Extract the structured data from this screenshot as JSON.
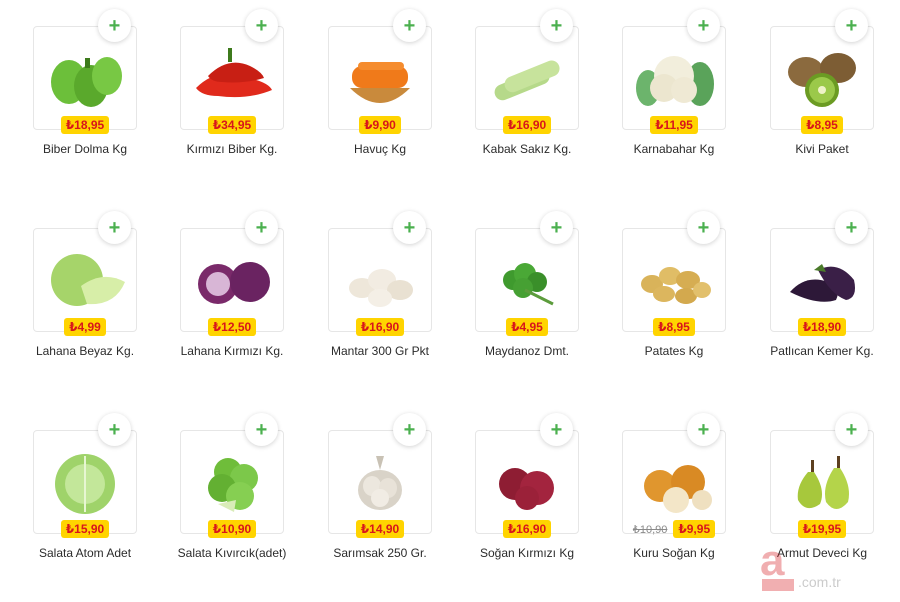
{
  "products": [
    {
      "name": "Biber Dolma Kg",
      "price": "₺18,95",
      "old_price": "",
      "icon": "green-pepper-icon"
    },
    {
      "name": "Kırmızı Biber Kg.",
      "price": "₺34,95",
      "old_price": "",
      "icon": "red-pepper-icon"
    },
    {
      "name": "Havuç Kg",
      "price": "₺9,90",
      "old_price": "",
      "icon": "carrot-icon"
    },
    {
      "name": "Kabak Sakız Kg.",
      "price": "₺16,90",
      "old_price": "",
      "icon": "zucchini-icon"
    },
    {
      "name": "Karnabahar Kg",
      "price": "₺11,95",
      "old_price": "",
      "icon": "cauliflower-icon"
    },
    {
      "name": "Kivi Paket",
      "price": "₺8,95",
      "old_price": "",
      "icon": "kiwi-icon"
    },
    {
      "name": "Lahana Beyaz Kg.",
      "price": "₺4,99",
      "old_price": "",
      "icon": "white-cabbage-icon"
    },
    {
      "name": "Lahana Kırmızı Kg.",
      "price": "₺12,50",
      "old_price": "",
      "icon": "red-cabbage-icon"
    },
    {
      "name": "Mantar 300 Gr Pkt",
      "price": "₺16,90",
      "old_price": "",
      "icon": "mushroom-icon"
    },
    {
      "name": "Maydanoz Dmt.",
      "price": "₺4,95",
      "old_price": "",
      "icon": "parsley-icon"
    },
    {
      "name": "Patates Kg",
      "price": "₺8,95",
      "old_price": "",
      "icon": "potato-icon"
    },
    {
      "name": "Patlıcan Kemer Kg.",
      "price": "₺18,90",
      "old_price": "",
      "icon": "eggplant-icon"
    },
    {
      "name": "Salata Atom Adet",
      "price": "₺15,90",
      "old_price": "",
      "icon": "iceberg-lettuce-icon"
    },
    {
      "name": "Salata Kıvırcık(adet)",
      "price": "₺10,90",
      "old_price": "",
      "icon": "curly-lettuce-icon"
    },
    {
      "name": "Sarımsak 250 Gr.",
      "price": "₺14,90",
      "old_price": "",
      "icon": "garlic-icon"
    },
    {
      "name": "Soğan Kırmızı Kg",
      "price": "₺16,90",
      "old_price": "",
      "icon": "red-onion-icon"
    },
    {
      "name": "Kuru Soğan Kg",
      "price": "₺9,95",
      "old_price": "₺10,90",
      "icon": "onion-icon"
    },
    {
      "name": "Armut Deveci Kg",
      "price": "₺19,95",
      "old_price": "",
      "icon": "pear-icon"
    }
  ],
  "add_label": "+",
  "colors": {
    "price_bg": "#ffd400",
    "price_text": "#d8161b",
    "add_icon": "#4bb04f"
  }
}
